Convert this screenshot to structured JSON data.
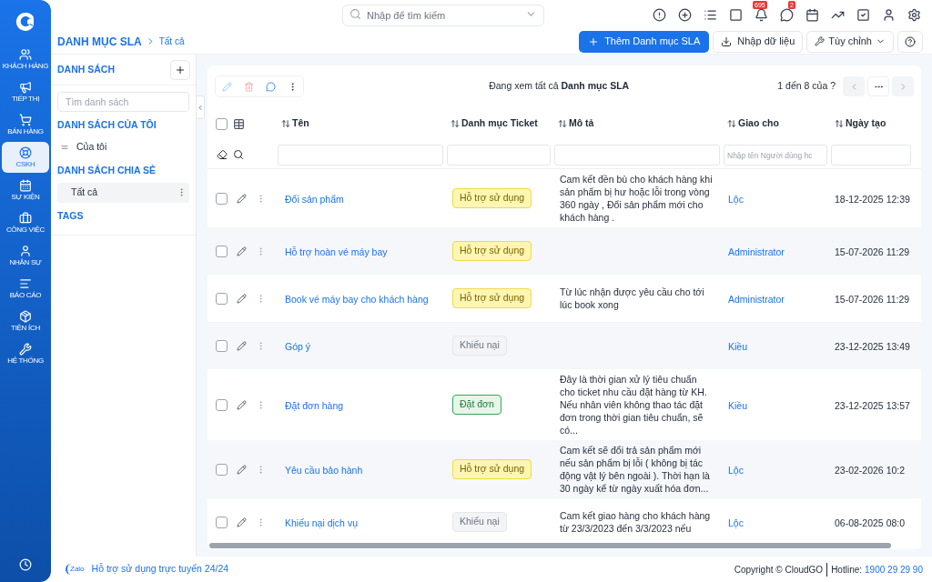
{
  "nav": {
    "items": [
      {
        "label": "KHÁCH HÀNG",
        "selected": false
      },
      {
        "label": "TIẾP THỊ",
        "selected": false
      },
      {
        "label": "BÁN HÀNG",
        "selected": false
      },
      {
        "label": "CSKH",
        "selected": true
      },
      {
        "label": "SỰ KIỆN",
        "selected": false
      },
      {
        "label": "CÔNG VIỆC",
        "selected": false
      },
      {
        "label": "NHÂN SỰ",
        "selected": false
      },
      {
        "label": "BÁO CÁO",
        "selected": false
      },
      {
        "label": "TIỆN ÍCH",
        "selected": false
      },
      {
        "label": "HỆ THỐNG",
        "selected": false
      }
    ]
  },
  "topbar": {
    "search_placeholder": "Nhập để tìm kiếm",
    "notification_badge": "695",
    "message_badge": "2"
  },
  "breadcrumb": {
    "title": "DANH MỤC SLA",
    "current": "Tất cả"
  },
  "actions": {
    "add": "Thêm Danh mục SLA",
    "import": "Nhập dữ liệu",
    "customize": "Tùy chỉnh"
  },
  "lists_panel": {
    "title": "DANH SÁCH",
    "search_placeholder": "Tìm danh sách",
    "sections": [
      {
        "title": "DANH SÁCH CỦA TÔI",
        "items": [
          {
            "label": "Của tôi",
            "selected": false,
            "kind": "mine"
          }
        ]
      },
      {
        "title": "DANH SÁCH CHIA SẺ",
        "items": [
          {
            "label": "Tất cả",
            "selected": true,
            "kind": "shared"
          }
        ]
      },
      {
        "title": "TAGS"
      }
    ]
  },
  "table": {
    "all_checked": false,
    "status": "Đang xem tất cả **Danh mục SLA**",
    "pagination": "1 đến 8 của ?",
    "columns": [
      {
        "label": "Tên"
      },
      {
        "label": "Danh mục Ticket"
      },
      {
        "label": "Mô tả"
      },
      {
        "label": "Giao cho",
        "filter_placeholder": "Nhập tên Người dùng hc"
      },
      {
        "label": "Ngày tạo"
      }
    ],
    "rows": [
      {
        "checked": false,
        "name": "Đổi sản phẩm",
        "category": {
          "label": "Hỗ trợ sử dụng",
          "kind": "support"
        },
        "description": "Cam kết đền bù cho khách hàng khi sản phẩm bị hư hoặc lỗi trong vòng 360 ngày , Đổi sản phẩm mới cho khách hàng .",
        "assignee": "Lộc",
        "created": "18-12-2025 12:39"
      },
      {
        "checked": false,
        "name": "Hỗ trợ hoàn vé máy bay",
        "category": {
          "label": "Hỗ trợ sử dụng",
          "kind": "support"
        },
        "assignee": "Administrator",
        "created": "15-07-2026 11:29"
      },
      {
        "checked": false,
        "name": "Book vé máy bay cho khách hàng",
        "category": {
          "label": "Hỗ trợ sử dụng",
          "kind": "support"
        },
        "description": "Từ lúc nhận được yêu cầu cho tới lúc book xong",
        "assignee": "Administrator",
        "created": "15-07-2026 11:29"
      },
      {
        "checked": false,
        "name": "Góp ý",
        "category": {
          "label": "Khiếu nại",
          "kind": "complaint"
        },
        "assignee": "Kiều",
        "created": "23-12-2025 13:49"
      },
      {
        "checked": false,
        "name": "Đặt đơn hàng",
        "category": {
          "label": "Đặt đơn",
          "kind": "order"
        },
        "description": "Đây là thời gian xử lý tiêu chuẩn cho ticket nhu cầu đặt hàng từ KH. Nếu nhân viên không thao tác đặt đơn trong thời gian tiêu chuẩn, sẽ có...",
        "assignee": "Kiều",
        "created": "23-12-2025 13:57"
      },
      {
        "checked": false,
        "name": "Yêu cầu bảo hành",
        "category": {
          "label": "Hỗ trợ sử dụng",
          "kind": "support"
        },
        "description": "Cam kết sẽ đổi trả sản phẩm mới nếu sản phẩm bị lỗi ( không bị tác động vật lý bên ngoài ). Thời hạn là 30 ngày kể từ ngày xuất hóa đơn...",
        "assignee": "Lộc",
        "created": "23-02-2026 10:2"
      },
      {
        "checked": false,
        "name": "Khiếu nại dịch vụ",
        "category": {
          "label": "Khiếu nại",
          "kind": "complaint"
        },
        "description": "Cam kết giao hàng cho khách hàng từ 23/3/2023 đến 3/3/2023 nếu",
        "assignee": "Lộc",
        "created": "06-08-2025 08:0"
      }
    ]
  },
  "footer": {
    "zalo_logo": "Zalo",
    "support": "Hỗ trợ sử dụng trực tuyến 24/24",
    "copyright": "Copyright © CloudGO",
    "hotline_label": "Hotline:",
    "hotline": "1900 29 29 90"
  }
}
